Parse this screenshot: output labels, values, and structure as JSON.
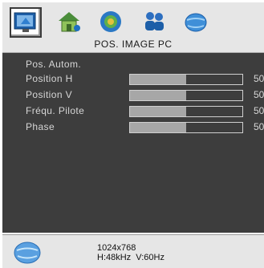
{
  "header": {
    "title": "POS. IMAGE PC",
    "tabs": [
      {
        "icon": "monitor-image-icon",
        "active": true
      },
      {
        "icon": "house-icon",
        "active": false
      },
      {
        "icon": "color-adjust-icon",
        "active": false
      },
      {
        "icon": "people-icon",
        "active": false
      },
      {
        "icon": "globe-icon",
        "active": false
      }
    ]
  },
  "menu": {
    "items": [
      {
        "label": "Pos. Autom."
      },
      {
        "label": "Position H",
        "value": "50",
        "level": 0.5
      },
      {
        "label": "Position V",
        "value": "50",
        "level": 0.5
      },
      {
        "label": "Fréqu. Pilote",
        "value": "50",
        "level": 0.5
      },
      {
        "label": "Phase",
        "value": "50",
        "level": 0.5
      }
    ]
  },
  "status": {
    "resolution": "1024x768",
    "frequency": "H:48kHz  V:60Hz"
  },
  "colors": {
    "panel": "#3d3d3d",
    "bar_fill": "#a7a7a7",
    "chrome": "#e6e6e6"
  }
}
